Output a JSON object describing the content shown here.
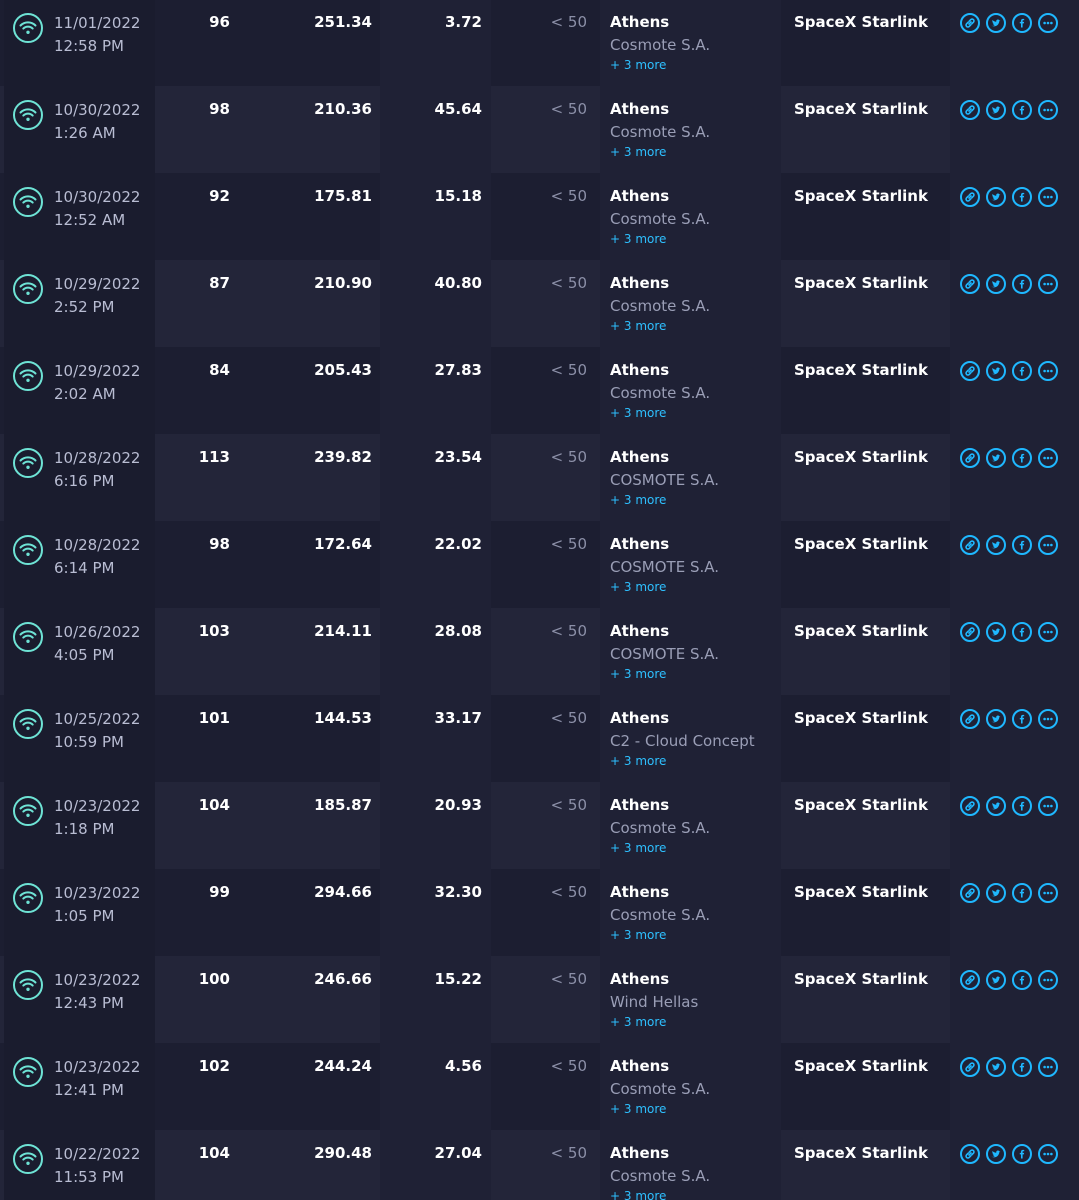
{
  "results": [
    {
      "date": "11/01/2022",
      "time": "12:58 PM",
      "ping": "96",
      "download": "251.34",
      "upload": "3.72",
      "packet_loss": "< 50",
      "city": "Athens",
      "server": "Cosmote S.A.",
      "more": "+ 3 more",
      "provider": "SpaceX Starlink"
    },
    {
      "date": "10/30/2022",
      "time": "1:26 AM",
      "ping": "98",
      "download": "210.36",
      "upload": "45.64",
      "packet_loss": "< 50",
      "city": "Athens",
      "server": "Cosmote S.A.",
      "more": "+ 3 more",
      "provider": "SpaceX Starlink"
    },
    {
      "date": "10/30/2022",
      "time": "12:52 AM",
      "ping": "92",
      "download": "175.81",
      "upload": "15.18",
      "packet_loss": "< 50",
      "city": "Athens",
      "server": "Cosmote S.A.",
      "more": "+ 3 more",
      "provider": "SpaceX Starlink"
    },
    {
      "date": "10/29/2022",
      "time": "2:52 PM",
      "ping": "87",
      "download": "210.90",
      "upload": "40.80",
      "packet_loss": "< 50",
      "city": "Athens",
      "server": "Cosmote S.A.",
      "more": "+ 3 more",
      "provider": "SpaceX Starlink"
    },
    {
      "date": "10/29/2022",
      "time": "2:02 AM",
      "ping": "84",
      "download": "205.43",
      "upload": "27.83",
      "packet_loss": "< 50",
      "city": "Athens",
      "server": "Cosmote S.A.",
      "more": "+ 3 more",
      "provider": "SpaceX Starlink"
    },
    {
      "date": "10/28/2022",
      "time": "6:16 PM",
      "ping": "113",
      "download": "239.82",
      "upload": "23.54",
      "packet_loss": "< 50",
      "city": "Athens",
      "server": "COSMOTE S.A.",
      "more": "+ 3 more",
      "provider": "SpaceX Starlink"
    },
    {
      "date": "10/28/2022",
      "time": "6:14 PM",
      "ping": "98",
      "download": "172.64",
      "upload": "22.02",
      "packet_loss": "< 50",
      "city": "Athens",
      "server": "COSMOTE S.A.",
      "more": "+ 3 more",
      "provider": "SpaceX Starlink"
    },
    {
      "date": "10/26/2022",
      "time": "4:05 PM",
      "ping": "103",
      "download": "214.11",
      "upload": "28.08",
      "packet_loss": "< 50",
      "city": "Athens",
      "server": "COSMOTE S.A.",
      "more": "+ 3 more",
      "provider": "SpaceX Starlink"
    },
    {
      "date": "10/25/2022",
      "time": "10:59 PM",
      "ping": "101",
      "download": "144.53",
      "upload": "33.17",
      "packet_loss": "< 50",
      "city": "Athens",
      "server": "C2 - Cloud Concept",
      "more": "+ 3 more",
      "provider": "SpaceX Starlink"
    },
    {
      "date": "10/23/2022",
      "time": "1:18 PM",
      "ping": "104",
      "download": "185.87",
      "upload": "20.93",
      "packet_loss": "< 50",
      "city": "Athens",
      "server": "Cosmote S.A.",
      "more": "+ 3 more",
      "provider": "SpaceX Starlink"
    },
    {
      "date": "10/23/2022",
      "time": "1:05 PM",
      "ping": "99",
      "download": "294.66",
      "upload": "32.30",
      "packet_loss": "< 50",
      "city": "Athens",
      "server": "Cosmote S.A.",
      "more": "+ 3 more",
      "provider": "SpaceX Starlink"
    },
    {
      "date": "10/23/2022",
      "time": "12:43 PM",
      "ping": "100",
      "download": "246.66",
      "upload": "15.22",
      "packet_loss": "< 50",
      "city": "Athens",
      "server": "Wind Hellas",
      "more": "+ 3 more",
      "provider": "SpaceX Starlink"
    },
    {
      "date": "10/23/2022",
      "time": "12:41 PM",
      "ping": "102",
      "download": "244.24",
      "upload": "4.56",
      "packet_loss": "< 50",
      "city": "Athens",
      "server": "Cosmote S.A.",
      "more": "+ 3 more",
      "provider": "SpaceX Starlink"
    },
    {
      "date": "10/22/2022",
      "time": "11:53 PM",
      "ping": "104",
      "download": "290.48",
      "upload": "27.04",
      "packet_loss": "< 50",
      "city": "Athens",
      "server": "Cosmote S.A.",
      "more": "+ 3 more",
      "provider": "SpaceX Starlink"
    }
  ],
  "icons": {
    "connection": "wifi-icon",
    "share_link": "link-icon",
    "share_twitter": "twitter-icon",
    "share_facebook": "facebook-icon",
    "options": "more-options-icon"
  },
  "colors": {
    "background": "#141526",
    "row_a": "#1c1e31",
    "row_b": "#232539",
    "accent_teal": "#6ee3d5",
    "accent_blue": "#1fb8ff",
    "link_blue": "#2ec0ff"
  }
}
